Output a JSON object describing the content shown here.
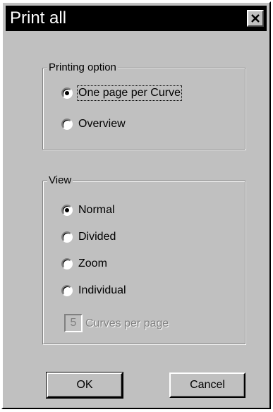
{
  "window": {
    "title": "Print all"
  },
  "printing_option": {
    "label": "Printing option",
    "options": [
      {
        "label": "One page per Curve",
        "selected": true
      },
      {
        "label": "Overview",
        "selected": false
      }
    ]
  },
  "view": {
    "label": "View",
    "options": [
      {
        "label": "Normal",
        "selected": true
      },
      {
        "label": "Divided",
        "selected": false
      },
      {
        "label": "Zoom",
        "selected": false
      },
      {
        "label": "Individual",
        "selected": false
      }
    ],
    "curves_per_page": {
      "value": "5",
      "label": "Curves per page"
    }
  },
  "buttons": {
    "ok": "OK",
    "cancel": "Cancel"
  }
}
